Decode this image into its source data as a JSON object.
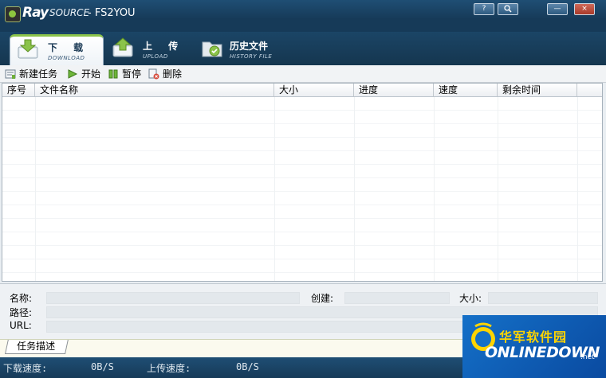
{
  "window": {
    "logo_main": "Ray",
    "logo_sub": "SOURCE",
    "title": "- FS2YOU",
    "buttons": [
      "?",
      "◦",
      "—",
      "×"
    ]
  },
  "tabs": [
    {
      "label": "下 载",
      "sub": "DOWNLOAD",
      "active": true
    },
    {
      "label": "上 传",
      "sub": "UPLOAD",
      "active": false
    },
    {
      "label": "历史文件",
      "sub": "HISTORY FILE",
      "active": false
    }
  ],
  "toolbar": {
    "new_task": "新建任务",
    "start": "开始",
    "pause": "暂停",
    "delete": "删除"
  },
  "table": {
    "columns": [
      "序号",
      "文件名称",
      "大小",
      "进度",
      "速度",
      "剩余时间"
    ]
  },
  "details": {
    "name_label": "名称:",
    "created_label": "创建:",
    "size_label": "大小:",
    "path_label": "路径:",
    "url_label": "URL:"
  },
  "desc_tab": "任务描述",
  "status": {
    "download_label": "下载速度:",
    "download_value": "0B/S",
    "upload_label": "上传速度:",
    "upload_value": "0B/S"
  },
  "watermark": {
    "cn": "华军软件园",
    "en": "ONLINEDOWN",
    "suffix": ".net"
  },
  "colors": {
    "titlebar": "#1f4e74",
    "accent_green": "#8bc34a",
    "watermark_blue": "#1470c8",
    "watermark_yellow": "#ffd400"
  }
}
